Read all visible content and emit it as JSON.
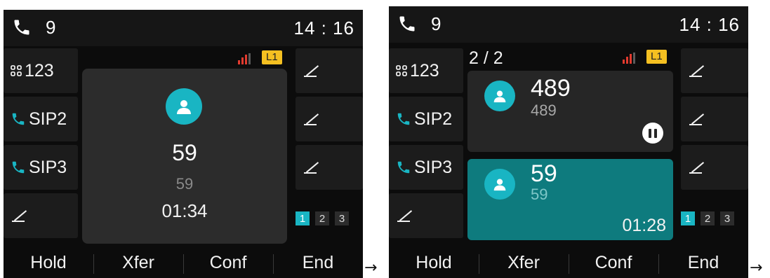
{
  "screens": [
    {
      "status": {
        "call_count": "9",
        "time": "14 : 16"
      },
      "line_keys_left": [
        {
          "label": "123",
          "icon": "grid-icon"
        },
        {
          "label": "SIP2",
          "icon": "phone-icon"
        },
        {
          "label": "SIP3",
          "icon": "phone-icon"
        },
        {
          "label": "",
          "icon": "pen-icon"
        }
      ],
      "line_keys_right": [
        {
          "icon": "pen-icon"
        },
        {
          "icon": "pen-icon"
        },
        {
          "icon": "pen-icon"
        }
      ],
      "line_badge": "L1",
      "call": {
        "name": "59",
        "number": "59",
        "duration": "01:34"
      },
      "pages": [
        "1",
        "2",
        "3"
      ],
      "softkeys": [
        "Hold",
        "Xfer",
        "Conf",
        "End"
      ]
    },
    {
      "status": {
        "call_count": "9",
        "time": "14 : 16"
      },
      "call_counter": "2 / 2",
      "line_keys_left": [
        {
          "label": "123",
          "icon": "grid-icon"
        },
        {
          "label": "SIP2",
          "icon": "phone-icon"
        },
        {
          "label": "SIP3",
          "icon": "phone-icon"
        },
        {
          "label": "",
          "icon": "pen-icon"
        }
      ],
      "line_keys_right": [
        {
          "icon": "pen-icon"
        },
        {
          "icon": "pen-icon"
        },
        {
          "icon": "pen-icon"
        }
      ],
      "line_badge": "L1",
      "held_call": {
        "name": "489",
        "number": "489",
        "state_icon": "pause-icon"
      },
      "active_call": {
        "name": "59",
        "number": "59",
        "duration": "01:28"
      },
      "pages": [
        "1",
        "2",
        "3"
      ],
      "softkeys": [
        "Hold",
        "Xfer",
        "Conf",
        "End"
      ]
    }
  ],
  "arrows": [
    "→",
    "→"
  ],
  "colors": {
    "accent": "#19b5c3",
    "active_card": "#0e7b7e",
    "badge": "#f5c021",
    "signal": "#e23a2e"
  }
}
